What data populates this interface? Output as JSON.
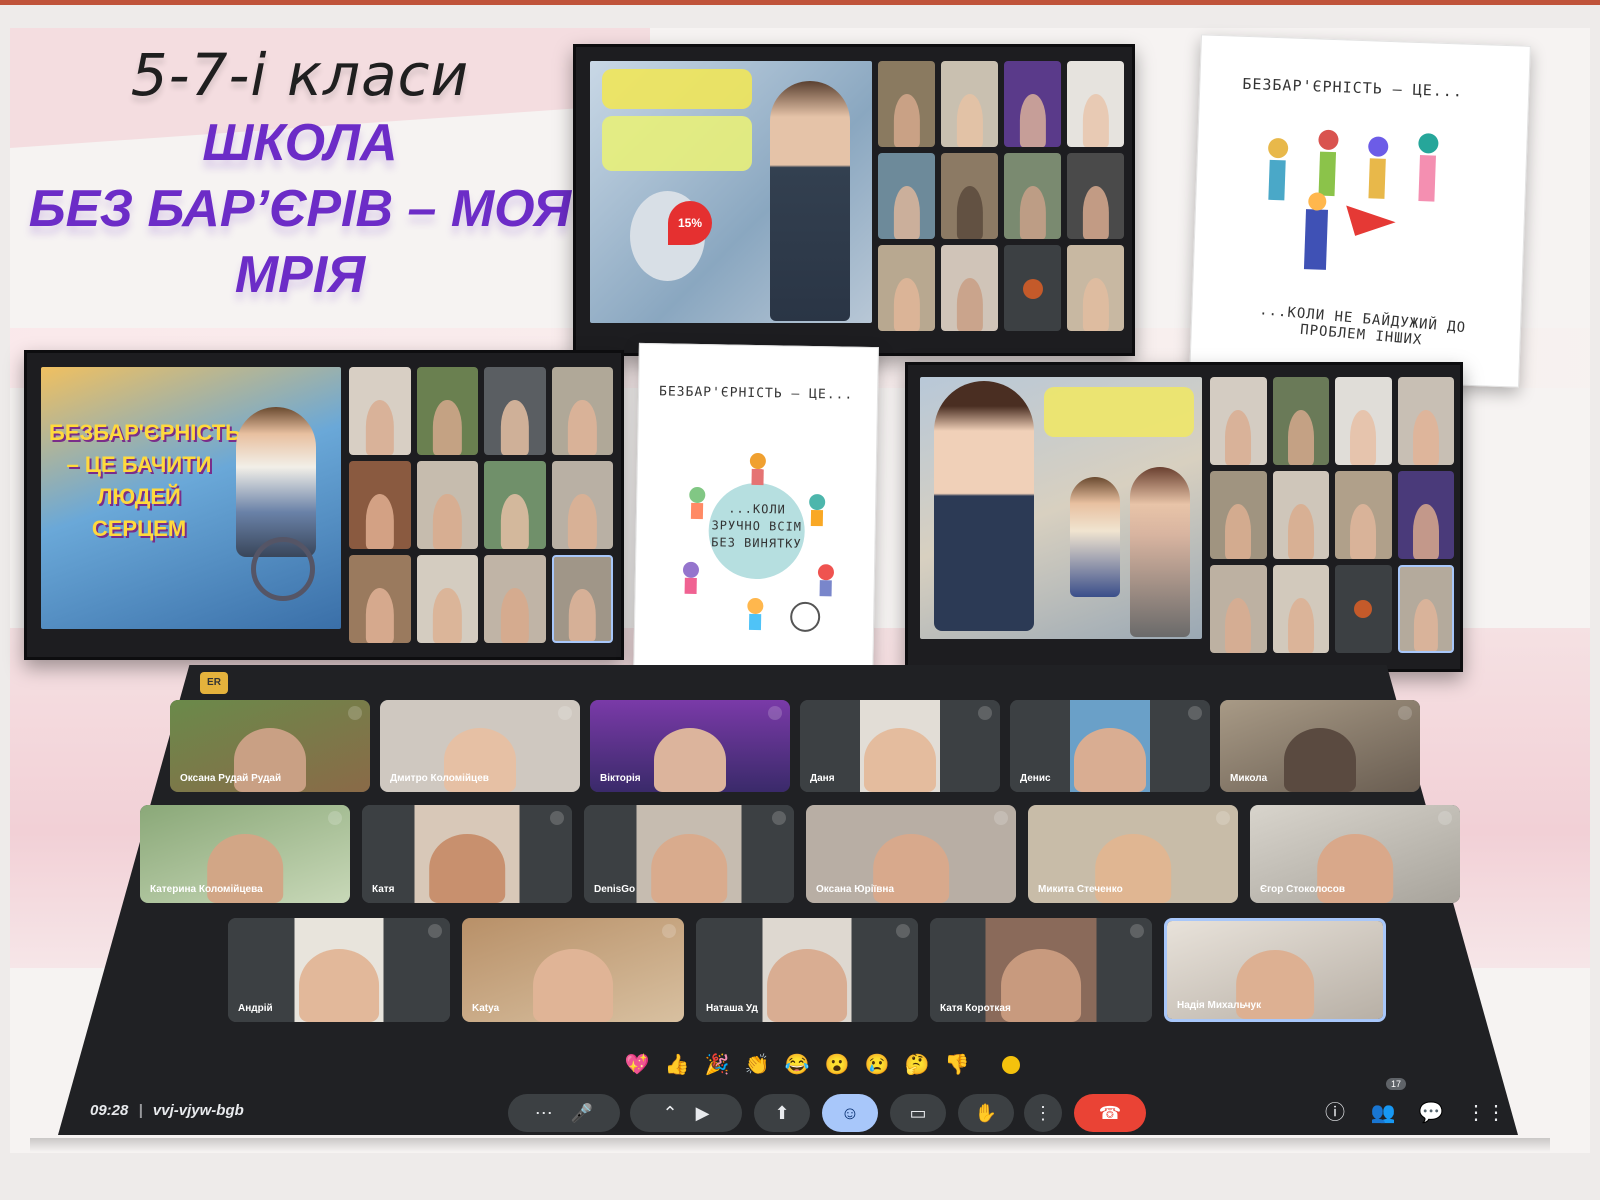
{
  "title": {
    "line1": "5-7-і класи",
    "line2": "ШКОЛА",
    "line3": "БЕЗ БАР’ЄРІВ – МОЯ",
    "line4": "МРІЯ"
  },
  "cards": {
    "top_right": {
      "header": "БЕЗБАР'ЄРНІСТЬ — ЦЕ...",
      "footer": "...КОЛИ НЕ БАЙДУЖИЙ ДО ПРОБЛЕМ ІНШИХ"
    },
    "middle": {
      "header": "БЕЗБАР'ЄРНІСТЬ — ЦЕ...",
      "center": "...КОЛИ ЗРУЧНО ВСІМ БЕЗ ВИНЯТКУ"
    }
  },
  "left_panel_slide_text": "БЕЗБАР'ЄРНІСТЬ – ЦЕ БАЧИТИ ЛЮДЕЙ СЕРЦЕМ",
  "top_panel_badge": "15%",
  "meet": {
    "badge": "ER",
    "participants": [
      "Оксана Рудай Рудай",
      "Дмитро Коломійцев",
      "Вікторія",
      "Даня",
      "Денис",
      "Микола",
      "Катерина Коломійцева",
      "Катя",
      "DenisGo",
      "Оксана Юріївна",
      "Микита Стеченко",
      "Єгор Стоколосов",
      "Андрій",
      "Katya",
      "Наташа Уд",
      "Катя Короткая",
      "Надія Михальчук"
    ],
    "time": "09:28",
    "code": "vvj-vjyw-bgb",
    "participant_count": "17",
    "reactions": [
      "💖",
      "👍",
      "🎉",
      "👏",
      "😂",
      "😮",
      "😢",
      "🤔",
      "👎"
    ],
    "colors": {
      "background": "#202124",
      "tile": "#3c4043",
      "end_call": "#ea4335",
      "active": "#a8c7fa",
      "accent_title": "#6c2cc7"
    }
  }
}
